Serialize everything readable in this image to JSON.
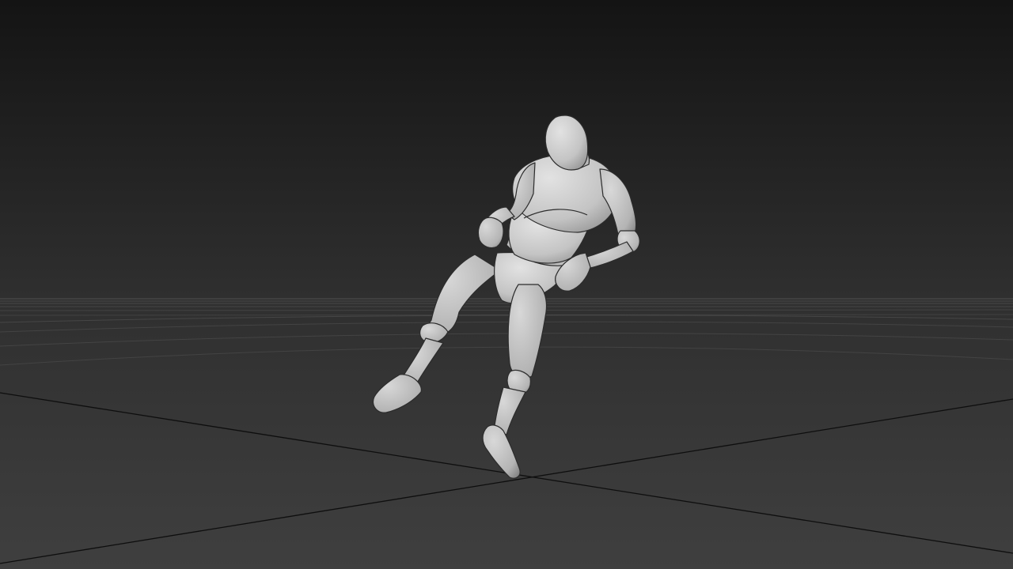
{
  "viewport": {
    "view_type": "perspective",
    "shading": "smooth-shaded",
    "background": {
      "top_color": "#141414",
      "horizon_color": "#2f2f2f",
      "bottom_color": "#3f3f3f"
    },
    "grid": {
      "visible": true,
      "line_color": "#5c5c5c",
      "axis_color": "#0e0e0e"
    },
    "model": {
      "name": "mannequin-figure",
      "pose": "leaning-back-kick",
      "surface_color": "#c9c9c9",
      "shadow_color": "#8e8e8e",
      "seam_color": "#2c2c2c"
    }
  }
}
